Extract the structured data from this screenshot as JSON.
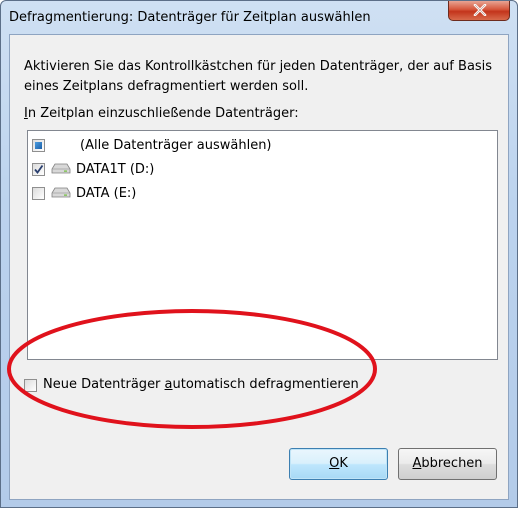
{
  "window": {
    "title": "Defragmentierung: Datenträger für Zeitplan auswählen",
    "close_icon": "close-icon"
  },
  "content": {
    "intro_line1": "Aktivieren Sie das Kontrollkästchen für jeden Datenträger, der auf Basis",
    "intro_line2": "eines Zeitplans defragmentiert werden soll.",
    "list_label_mnemonic": "I",
    "list_label_rest": "n Zeitplan einzuschließende Datenträger:"
  },
  "disks": [
    {
      "label": "(Alle Datenträger auswählen)",
      "state": "indeterminate",
      "icon": null
    },
    {
      "label": "DATA1T (D:)",
      "state": "checked",
      "icon": "drive-icon"
    },
    {
      "label": "DATA (E:)",
      "state": "unchecked",
      "icon": "drive-icon"
    }
  ],
  "auto_defrag": {
    "label_pre": "Neue Datenträger ",
    "label_mnemonic": "a",
    "label_post": "utomatisch defragmentieren",
    "checked": false
  },
  "buttons": {
    "ok_mnemonic": "O",
    "ok_rest": "K",
    "cancel_mnemonic": "A",
    "cancel_rest": "bbrechen"
  },
  "annotation": {
    "ellipse_color": "#e0121c"
  }
}
